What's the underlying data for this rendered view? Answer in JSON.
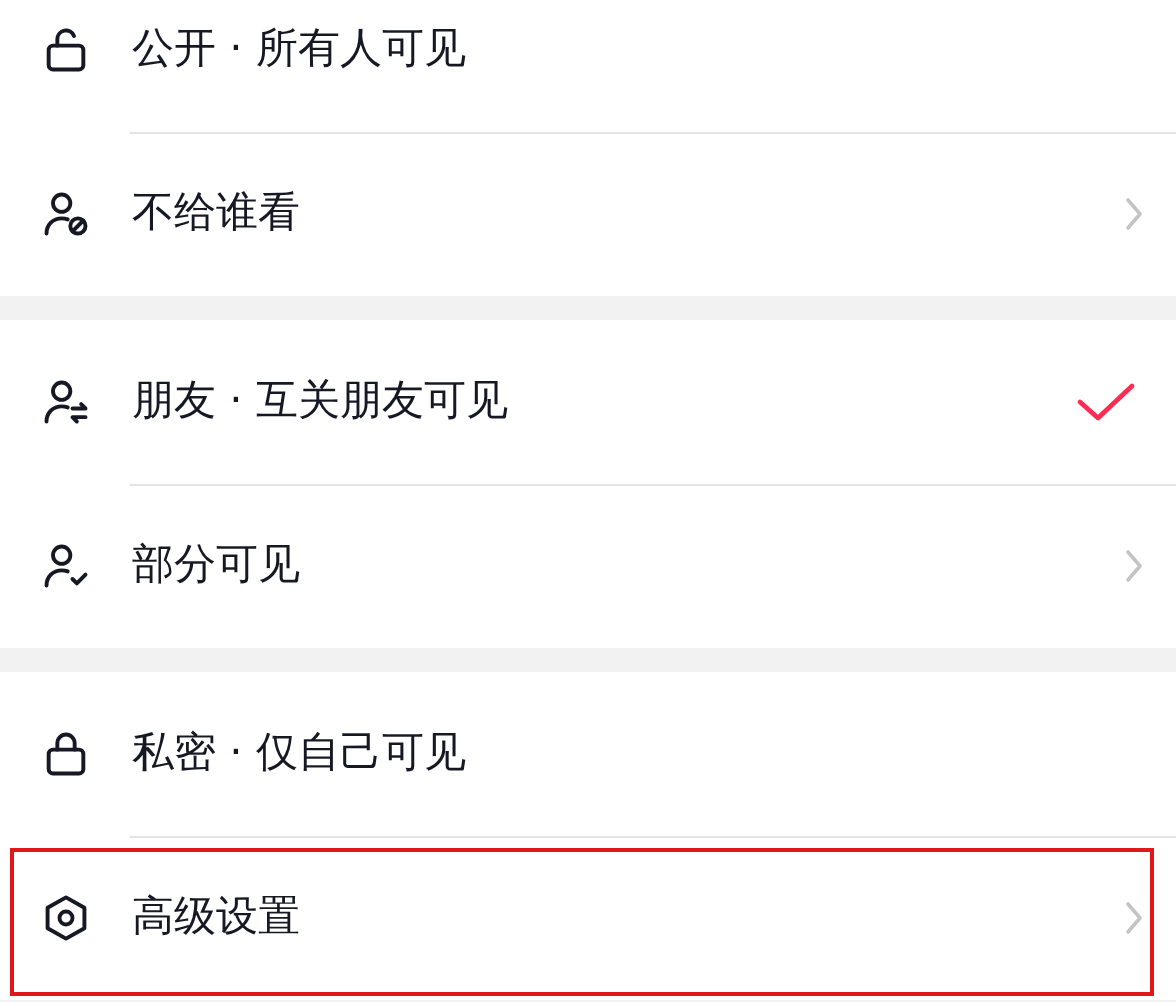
{
  "groups": [
    {
      "rows": [
        {
          "label": "公开 · 所有人可见",
          "selected": false,
          "expandable": false,
          "highlighted": false
        },
        {
          "label": "不给谁看",
          "selected": false,
          "expandable": true,
          "highlighted": false
        }
      ]
    },
    {
      "rows": [
        {
          "label": "朋友 · 互关朋友可见",
          "selected": true,
          "expandable": false,
          "highlighted": false
        },
        {
          "label": "部分可见",
          "selected": false,
          "expandable": true,
          "highlighted": false
        }
      ]
    },
    {
      "rows": [
        {
          "label": "私密 · 仅自己可见",
          "selected": false,
          "expandable": false,
          "highlighted": false
        },
        {
          "label": "高级设置",
          "selected": false,
          "expandable": true,
          "highlighted": true
        }
      ]
    }
  ]
}
